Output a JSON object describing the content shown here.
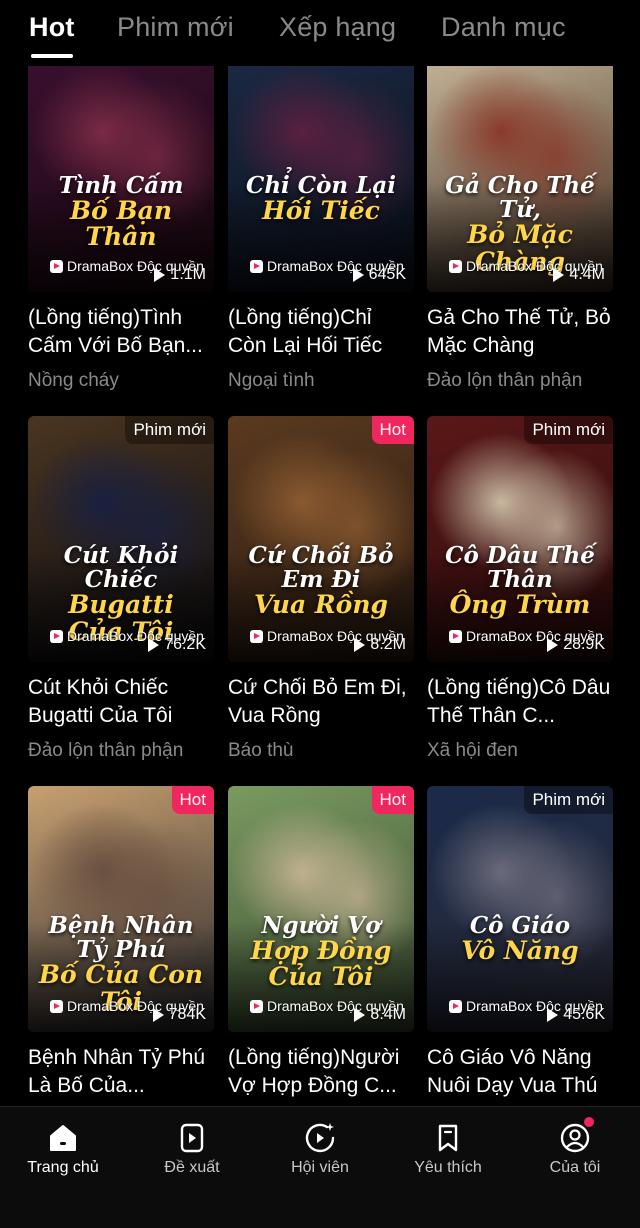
{
  "tabs": [
    {
      "label": "Hot",
      "active": true
    },
    {
      "label": "Phim mới",
      "active": false
    },
    {
      "label": "Xếp hạng",
      "active": false
    },
    {
      "label": "Danh mục",
      "active": false
    }
  ],
  "brand_label": "DramaBox Độc quyền",
  "cards": [
    {
      "badge": "",
      "poster_title": [
        "Tình Cấm",
        "Bố Bạn Thân"
      ],
      "views": "1.1M",
      "title": "(Lồng tiếng)Tình Cấm Với Bố Bạn...",
      "genre": "Nồng cháy",
      "colors": [
        "#3a1030",
        "#7a2a45",
        "#1a0810"
      ]
    },
    {
      "badge": "",
      "poster_title": [
        "Chỉ Còn Lại",
        "Hối Tiếc"
      ],
      "views": "645K",
      "title": "(Lồng tiếng)Chỉ Còn Lại Hối Tiếc",
      "genre": "Ngoại tình",
      "colors": [
        "#1b2a45",
        "#5a2040",
        "#0a0f1a"
      ]
    },
    {
      "badge": "",
      "poster_title": [
        "Gả Cho Thế Tử,",
        "Bỏ Mặc Chàng"
      ],
      "views": "4.4M",
      "title": "Gả Cho Thế Tử, Bỏ Mặc Chàng",
      "genre": "Đảo lộn thân phận",
      "colors": [
        "#c9b89a",
        "#8a3a2a",
        "#3a2a20"
      ]
    },
    {
      "badge": "Phim mới",
      "poster_title": [
        "Cút Khỏi Chiếc",
        "Bugatti Của Tôi"
      ],
      "views": "76.2K",
      "title": "Cút Khỏi Chiếc Bugatti Của Tôi",
      "genre": "Đảo lộn thân phận",
      "colors": [
        "#4a3520",
        "#1a2040",
        "#0a0a10"
      ]
    },
    {
      "badge": "Hot",
      "poster_title": [
        "Cứ Chối Bỏ Em Đi",
        "Vua Rồng"
      ],
      "views": "8.2M",
      "title": "Cứ Chối Bỏ Em Đi, Vua Rồng",
      "genre": "Báo thù",
      "colors": [
        "#5a3a20",
        "#8a5a30",
        "#2a1a10"
      ]
    },
    {
      "badge": "Phim mới",
      "poster_title": [
        "Cô Dâu Thế Thân",
        "Ông Trùm"
      ],
      "views": "28.9K",
      "title": "(Lồng tiếng)Cô Dâu Thế Thân C...",
      "genre": "Xã hội đen",
      "colors": [
        "#5a1818",
        "#c8b8a0",
        "#2a0a0a"
      ]
    },
    {
      "badge": "Hot",
      "poster_title": [
        "Bệnh Nhân Tỷ Phú",
        "Bố Của Con Tôi"
      ],
      "views": "784K",
      "title": "Bệnh Nhân Tỷ Phú Là Bố Của...",
      "genre": "",
      "colors": [
        "#c8a070",
        "#6a5040",
        "#2a2a30"
      ]
    },
    {
      "badge": "Hot",
      "poster_title": [
        "Người Vợ",
        "Hợp Đồng Của Tôi"
      ],
      "views": "8.4M",
      "title": "(Lồng tiếng)Người Vợ Hợp Đồng C...",
      "genre": "",
      "colors": [
        "#7a9a60",
        "#c0b090",
        "#3a4a30"
      ]
    },
    {
      "badge": "Phim mới",
      "poster_title": [
        "Cô Giáo",
        "Vô Năng"
      ],
      "views": "45.6K",
      "title": "Cô Giáo Vô Năng Nuôi Dạy Vua Thú",
      "genre": "",
      "colors": [
        "#1a2a4a",
        "#6a6a7a",
        "#2a2a35"
      ]
    }
  ],
  "nav": [
    {
      "label": "Trang chủ",
      "icon": "home-icon",
      "active": true
    },
    {
      "label": "Đề xuất",
      "icon": "play-card-icon",
      "active": false
    },
    {
      "label": "Hội viên",
      "icon": "vip-play-icon",
      "active": false
    },
    {
      "label": "Yêu thích",
      "icon": "bookmark-icon",
      "active": false
    },
    {
      "label": "Của tôi",
      "icon": "profile-icon",
      "active": false,
      "notification": true
    }
  ]
}
